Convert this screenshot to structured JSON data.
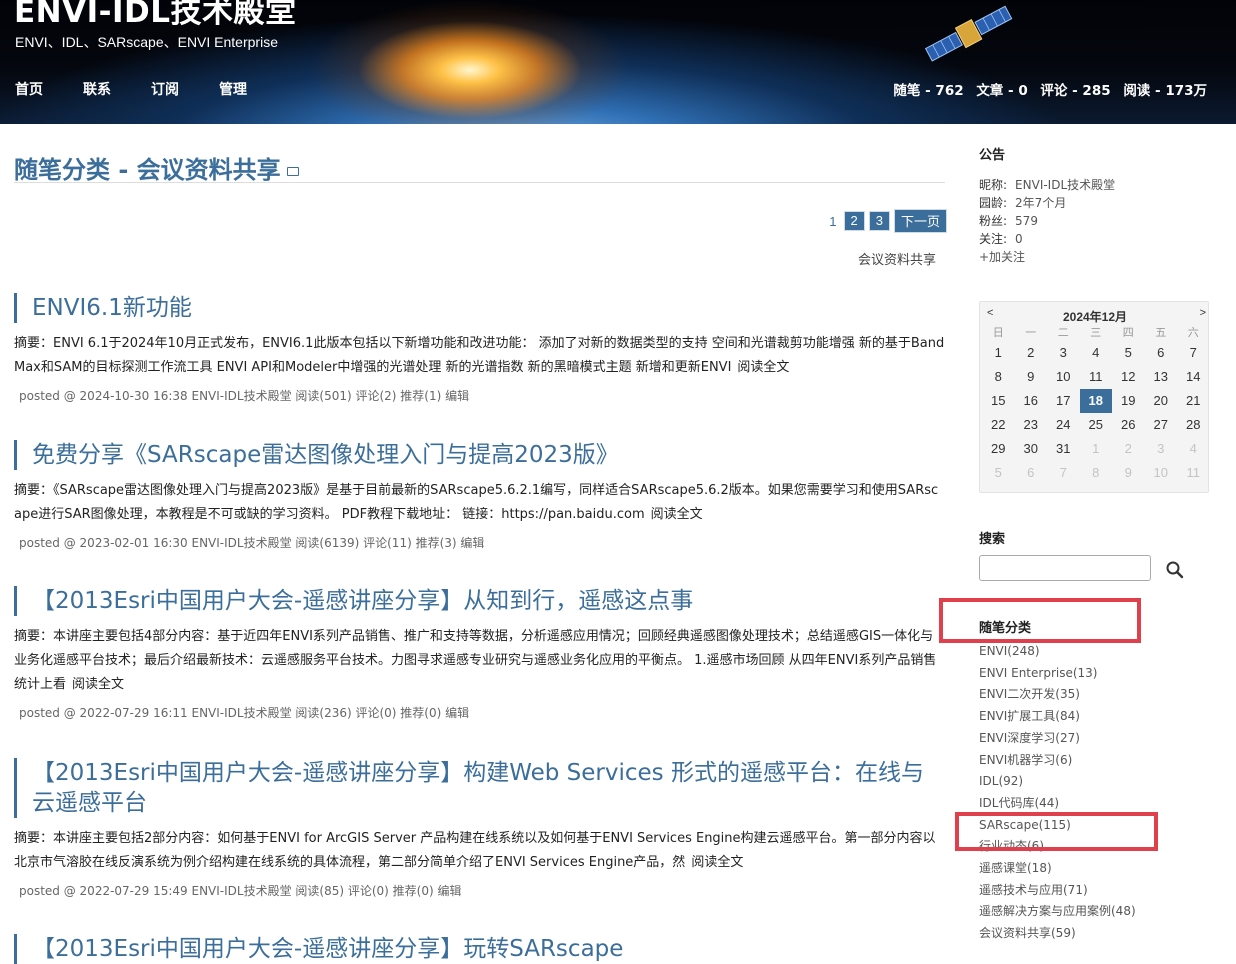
{
  "header": {
    "blog_title": "ENVI-IDL技术殿堂",
    "subtitle": "ENVI、IDL、SARscape、ENVI Enterprise",
    "nav": [
      "首页",
      "联系",
      "订阅",
      "管理"
    ],
    "stats": {
      "posts": "随笔 - 762",
      "articles": "文章 - 0",
      "comments": "评论 - 285",
      "reads": "阅读 - 173万"
    }
  },
  "main": {
    "heading": "随笔分类 -  会议资料共享",
    "pager": {
      "current": "1",
      "pages": [
        "2",
        "3"
      ],
      "next": "下一页"
    },
    "category_desc": "会议资料共享",
    "posts": [
      {
        "title": "ENVI6.1新功能",
        "summary": "摘要：ENVI 6.1于2024年10月正式发布，ENVI6.1此版本包括以下新增功能和改进功能： 添加了对新的数据类型的支持 空间和光谱裁剪功能增强 新的基于BandMax和SAM的目标探测工作流工具 ENVI API和Modeler中增强的光谱处理 新的光谱指数 新的黑暗模式主题 新增和更新ENVI",
        "more": "阅读全文",
        "meta_prefix": "posted @ 2024-10-30 16:38 ENVI-IDL技术殿堂 阅读(501) 评论(2) 推荐(1)",
        "edit": "编辑"
      },
      {
        "title": "免费分享《SARscape雷达图像处理入门与提高2023版》",
        "summary": "摘要：《SARscape雷达图像处理入门与提高2023版》是基于目前最新的SARscape5.6.2.1编写，同样适合SARscape5.6.2版本。如果您需要学习和使用SARscape进行SAR图像处理，本教程是不可或缺的学习资料。 PDF教程下载地址： 链接：https://pan.baidu.com",
        "more": "阅读全文",
        "meta_prefix": "posted @ 2023-02-01 16:30 ENVI-IDL技术殿堂 阅读(6139) 评论(11) 推荐(3)",
        "edit": "编辑"
      },
      {
        "title": "【2013Esri中国用户大会-遥感讲座分享】从知到行，遥感这点事",
        "summary": "摘要：本讲座主要包括4部分内容：基于近四年ENVI系列产品销售、推广和支持等数据，分析遥感应用情况；回顾经典遥感图像处理技术；总结遥感GIS一体化与业务化遥感平台技术；最后介绍最新技术：云遥感服务平台技术。力图寻求遥感专业研究与遥感业务化应用的平衡点。 1.遥感市场回顾 从四年ENVI系列产品销售统计上看",
        "more": "阅读全文",
        "meta_prefix": "posted @ 2022-07-29 16:11 ENVI-IDL技术殿堂 阅读(236) 评论(0) 推荐(0)",
        "edit": "编辑"
      },
      {
        "title": "【2013Esri中国用户大会-遥感讲座分享】构建Web Services 形式的遥感平台：在线与云遥感平台",
        "summary": "摘要：本讲座主要包括2部分内容：如何基于ENVI for ArcGIS Server 产品构建在线系统以及如何基于ENVI Services Engine构建云遥感平台。第一部分内容以北京市气溶胶在线反演系统为例介绍构建在线系统的具体流程，第二部分简单介绍了ENVI Services Engine产品，然",
        "more": "阅读全文",
        "meta_prefix": "posted @ 2022-07-29 15:49 ENVI-IDL技术殿堂 阅读(85) 评论(0) 推荐(0)",
        "edit": "编辑"
      },
      {
        "title": "【2013Esri中国用户大会-遥感讲座分享】玩转SARscape"
      }
    ]
  },
  "sidebar": {
    "notice_title": "公告",
    "profile": {
      "nickname_label": "昵称:",
      "nickname": "ENVI-IDL技术殿堂",
      "age_label": "园龄:",
      "age": "2年7个月",
      "fans_label": "粉丝:",
      "fans": "579",
      "follow_label": "关注:",
      "follow": "0",
      "add_follow": "+加关注"
    },
    "calendar": {
      "prev": "<",
      "title": "2024年12月",
      "next": ">",
      "weekdays": [
        "日",
        "一",
        "二",
        "三",
        "四",
        "五",
        "六"
      ],
      "weeks": [
        [
          "1",
          "2",
          "3",
          "4",
          "5",
          "6",
          "7"
        ],
        [
          "8",
          "9",
          "10",
          "11",
          "12",
          "13",
          "14"
        ],
        [
          "15",
          "16",
          "17",
          "18",
          "19",
          "20",
          "21"
        ],
        [
          "22",
          "23",
          "24",
          "25",
          "26",
          "27",
          "28"
        ],
        [
          "29",
          "30",
          "31",
          "1",
          "2",
          "3",
          "4"
        ],
        [
          "5",
          "6",
          "7",
          "8",
          "9",
          "10",
          "11"
        ]
      ],
      "today": "18"
    },
    "search_title": "搜索",
    "category_title": "随笔分类",
    "categories": [
      "ENVI(248)",
      "ENVI Enterprise(13)",
      "ENVI二次开发(35)",
      "ENVI扩展工具(84)",
      "ENVI深度学习(27)",
      "ENVI机器学习(6)",
      "IDL(92)",
      "IDL代码库(44)",
      "SARscape(115)",
      "行业动态(6)",
      "遥感课堂(18)",
      "遥感技术与应用(71)",
      "遥感解决方案与应用案例(48)",
      "会议资料共享(59)"
    ]
  },
  "colors": {
    "accent": "#3b6e9a",
    "highlight_box": "#e0404c"
  }
}
